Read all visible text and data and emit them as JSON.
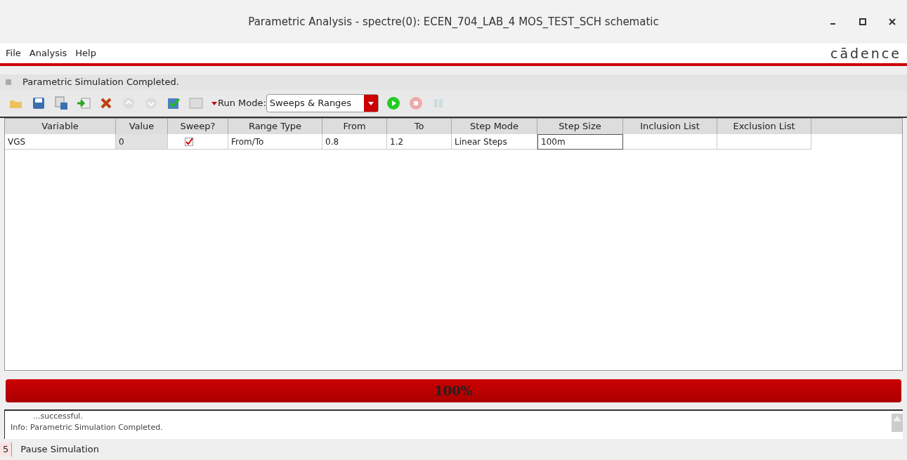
{
  "window": {
    "title": "Parametric Analysis - spectre(0): ECEN_704_LAB_4 MOS_TEST_SCH schematic"
  },
  "menu": [
    "File",
    "Analysis",
    "Help"
  ],
  "logo": "cādence",
  "message": "Parametric Simulation Completed.",
  "toolbar": {
    "run_mode_label": "Run Mode:",
    "run_mode": "Sweeps & Ranges"
  },
  "table": {
    "columns": [
      "Variable",
      "Value",
      "Sweep?",
      "Range Type",
      "From",
      "To",
      "Step Mode",
      "Step Size",
      "Inclusion List",
      "Exclusion List"
    ],
    "rows": [
      {
        "variable": "VGS",
        "value": "0",
        "sweep": true,
        "range_type": "From/To",
        "from": "0.8",
        "to": "1.2",
        "step_mode": "Linear Steps",
        "step_size": "100m"
      }
    ]
  },
  "progress": {
    "level": 1,
    "label": "100%"
  },
  "log": [
    "...successful.",
    "Info: Parametric Simulation Completed."
  ],
  "status_bar": {
    "number": "5",
    "text": "Pause Simulation"
  }
}
